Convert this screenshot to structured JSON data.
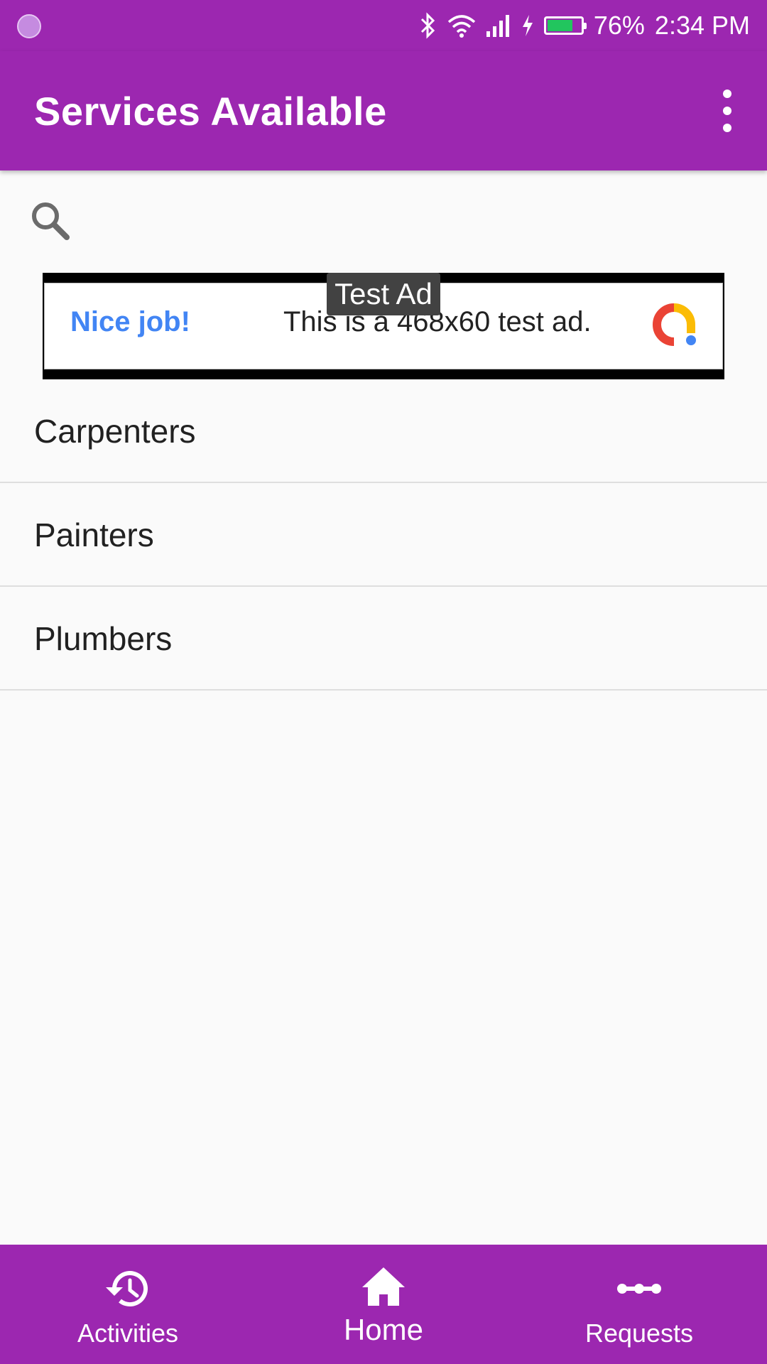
{
  "status_bar": {
    "battery_percent": "76%",
    "time": "2:34 PM",
    "battery_color": "#22c55e"
  },
  "app_bar": {
    "title": "Services Available",
    "background_color": "#9c27b0"
  },
  "search": {
    "value": "",
    "icon": "search-icon"
  },
  "ad": {
    "label": "Test Ad",
    "headline": "Nice job!",
    "body": "This is a 468x60 test ad."
  },
  "services": [
    {
      "label": "Carpenters"
    },
    {
      "label": "Painters"
    },
    {
      "label": "Plumbers"
    }
  ],
  "bottom_nav": {
    "items": [
      {
        "label": "Activities",
        "icon": "history-icon"
      },
      {
        "label": "Home",
        "icon": "home-icon",
        "active": true
      },
      {
        "label": "Requests",
        "icon": "more-horizontal-icon"
      }
    ]
  }
}
